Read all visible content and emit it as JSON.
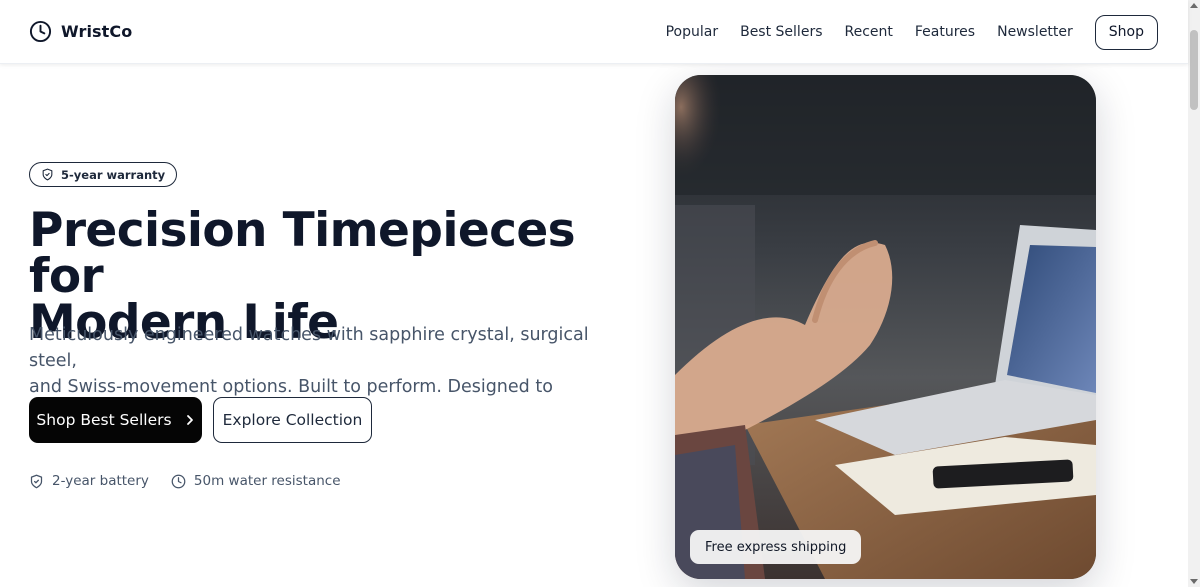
{
  "header": {
    "brand": "WristCo",
    "brand_icon": "clock-icon",
    "nav": [
      "Popular",
      "Best Sellers",
      "Recent",
      "Features",
      "Newsletter"
    ],
    "shop_label": "Shop"
  },
  "hero": {
    "badge": "5-year warranty",
    "badge_icon": "shield-check-icon",
    "headline_line1": "Precision Timepieces for",
    "headline_line2": "Modern Life",
    "subtext_line1": "Meticulously engineered watches with sapphire crystal, surgical steel,",
    "subtext_line2": "and Swiss-movement options. Built to perform. Designed to impress.",
    "primary_cta": "Shop Best Sellers",
    "primary_cta_icon": "chevron-right-icon",
    "secondary_cta": "Explore Collection",
    "features": [
      {
        "label": "2-year battery",
        "icon": "shield-check-icon"
      },
      {
        "label": "50m water resistance",
        "icon": "clock-icon"
      }
    ]
  },
  "image_card": {
    "caption": "Free express shipping"
  },
  "colors": {
    "text_primary": "#0f172a",
    "text_muted": "#475569",
    "button_dark": "#050505",
    "background": "#ffffff"
  }
}
